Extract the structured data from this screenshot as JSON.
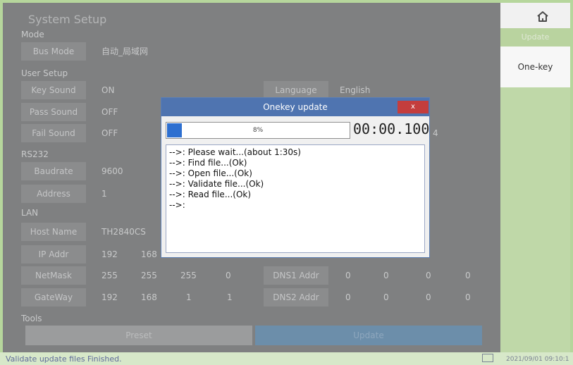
{
  "header": {
    "title": "System Setup",
    "home_icon": "home-icon"
  },
  "sections": {
    "mode": "Mode",
    "user_setup": "User Setup",
    "rs232": "RS232",
    "lan": "LAN",
    "tools": "Tools"
  },
  "mode": {
    "bus_mode_label": "Bus Mode",
    "bus_mode_value": "自动_局域网"
  },
  "user": {
    "key_sound_label": "Key Sound",
    "key_sound_value": "ON",
    "pass_sound_label": "Pass Sound",
    "pass_sound_value": "OFF",
    "fail_sound_label": "Fail Sound",
    "fail_sound_value": "OFF",
    "language_label": "Language",
    "language_value": "English",
    "partial_value": "4"
  },
  "rs232": {
    "baudrate_label": "Baudrate",
    "baudrate_value": "9600",
    "address_label": "Address",
    "address_value": "1"
  },
  "lan": {
    "host_name_label": "Host Name",
    "host_name_value": "TH2840CS",
    "ip_label": "IP Addr",
    "ip_1": "192",
    "ip_2": "168",
    "netmask_label": "NetMask",
    "nm_1": "255",
    "nm_2": "255",
    "nm_3": "255",
    "nm_4": "0",
    "gateway_label": "GateWay",
    "gw_1": "192",
    "gw_2": "168",
    "gw_3": "1",
    "gw_4": "1",
    "dns1_label": "DNS1 Addr",
    "dns1_1": "0",
    "dns1_2": "0",
    "dns1_3": "0",
    "dns1_4": "0",
    "dns2_label": "DNS2 Addr",
    "dns2_1": "0",
    "dns2_2": "0",
    "dns2_3": "0",
    "dns2_4": "0"
  },
  "tools": {
    "preset_label": "Preset",
    "update_label": "Update"
  },
  "sidebar": {
    "update_tab": "Update",
    "onekey_label": "One-key"
  },
  "status": {
    "message": "Validate update files Finished.",
    "time": "2021/09/01 09:10:1"
  },
  "modal": {
    "title": "Onekey update",
    "close_label": "x",
    "progress_text": "8%",
    "progress_value": 0.08,
    "timer": "00:00.100",
    "log": [
      "-->: Please wait...(about 1:30s)",
      "-->: Find file...(Ok)",
      "-->: Open file...(Ok)",
      "-->: Validate file...(Ok)",
      "-->: Read file...(Ok)",
      "-->:"
    ]
  }
}
